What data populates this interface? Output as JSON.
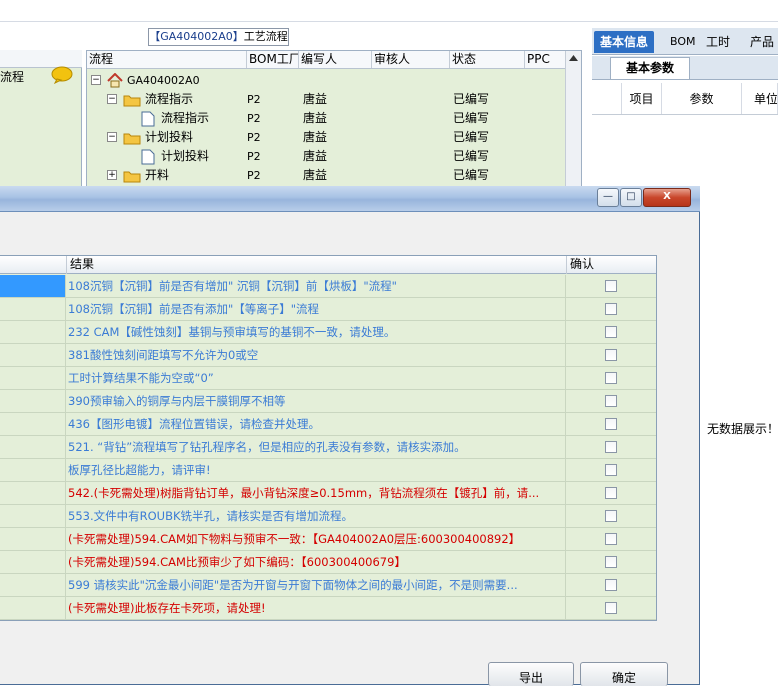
{
  "process_panel": {
    "title_code": "【GA404002A0】",
    "title_text": "工艺流程",
    "left_label": "流程",
    "columns": [
      "流程",
      "BOM工厂",
      "编写人",
      "审核人",
      "状态",
      "PPC"
    ],
    "rows": [
      {
        "name": "GA404002A0",
        "factory": "",
        "writer": "",
        "reviewer": "",
        "status": "",
        "icon": "house-icon"
      },
      {
        "name": "流程指示",
        "factory": "P2",
        "writer": "唐益",
        "reviewer": "",
        "status": "已编写",
        "icon": "folder-icon"
      },
      {
        "name": "流程指示",
        "factory": "P2",
        "writer": "唐益",
        "reviewer": "",
        "status": "已编写",
        "icon": "document-icon"
      },
      {
        "name": "计划投料",
        "factory": "P2",
        "writer": "唐益",
        "reviewer": "",
        "status": "已编写",
        "icon": "folder-icon"
      },
      {
        "name": "计划投料",
        "factory": "P2",
        "writer": "唐益",
        "reviewer": "",
        "status": "已编写",
        "icon": "document-icon"
      },
      {
        "name": "开料",
        "factory": "P2",
        "writer": "唐益",
        "reviewer": "",
        "status": "已编写",
        "icon": "folder-icon"
      }
    ]
  },
  "right_panel": {
    "tabs": [
      "基本信息",
      "BOM",
      "工时",
      "产品"
    ],
    "subtab": "基本参数",
    "columns": [
      "项目",
      "参数",
      "单位"
    ],
    "empty_text": "无数据展示！"
  },
  "dialog": {
    "columns": [
      "结果",
      "确认"
    ],
    "rows": [
      {
        "text": "108沉铜【沉铜】前是否有增加\" 沉铜【沉铜】前【烘板】\"流程\"",
        "color": "#3a7bd5"
      },
      {
        "text": "108沉铜【沉铜】前是否有添加\"【等离子】\"流程",
        "color": "#3a7bd5"
      },
      {
        "text": "232 CAM【碱性蚀刻】基铜与预审填写的基铜不一致，请处理。",
        "color": "#3a7bd5"
      },
      {
        "text": "381酸性蚀刻间距填写不允许为0或空",
        "color": "#3a7bd5"
      },
      {
        "text": "工时计算结果不能为空或“0”",
        "color": "#3a7bd5"
      },
      {
        "text": "390预审输入的铜厚与内层干膜铜厚不相等",
        "color": "#3a7bd5"
      },
      {
        "text": "436【图形电镀】流程位置错误，请检查并处理。",
        "color": "#3a7bd5"
      },
      {
        "text": "521. “背钻”流程填写了钻孔程序名，但是相应的孔表没有参数，请核实添加。",
        "color": "#3a7bd5"
      },
      {
        "text": "板厚孔径比超能力，请评审!",
        "color": "#3a7bd5"
      },
      {
        "text": "542.(卡死需处理)树脂背钻订单，最小背钻深度≥0.15mm，背钻流程须在【镀孔】前，请...",
        "color": "#d40000"
      },
      {
        "text": "553.文件中有ROUBK铣半孔，请核实是否有增加流程。",
        "color": "#3a7bd5"
      },
      {
        "text": "(卡死需处理)594.CAM如下物料与预审不一致：【GA404002A0层压:600300400892】",
        "color": "#d40000"
      },
      {
        "text": "(卡死需处理)594.CAM比预审少了如下编码：【600300400679】",
        "color": "#d40000"
      },
      {
        "text": "599 请核实此\"沉金最小间距\"是否为开窗与开窗下面物体之间的最小间距，不是则需要...",
        "color": "#3a7bd5"
      },
      {
        "text": "(卡死需处理)此板存在卡死项，请处理!",
        "color": "#d40000"
      }
    ],
    "buttons": {
      "export": "导出",
      "ok": "确定"
    },
    "window_buttons": {
      "minimize": "—",
      "maximize": "□",
      "close": "X"
    },
    "selected_row": 0,
    "colors": {
      "grid_bg": "#e4efd9",
      "selected": "#3399ff",
      "titlebar": "#a8c2e4"
    }
  }
}
